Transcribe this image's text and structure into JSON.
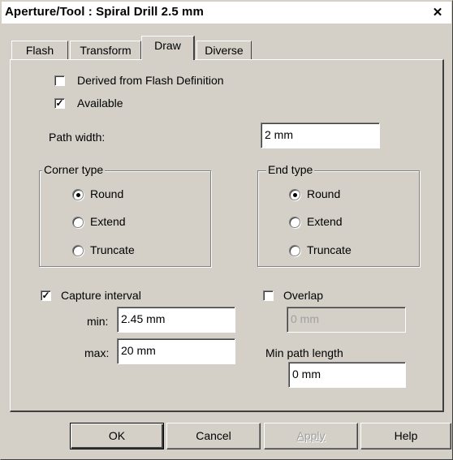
{
  "window": {
    "title": "Aperture/Tool : Spiral Drill 2.5 mm",
    "close_glyph": "✕"
  },
  "tabs": [
    {
      "label": "Flash"
    },
    {
      "label": "Transform"
    },
    {
      "label": "Draw",
      "active": true
    },
    {
      "label": "Diverse"
    }
  ],
  "draw": {
    "derived_label": "Derived from Flash Definition",
    "derived_checked": false,
    "available_label": "Available",
    "available_checked": true,
    "path_width_label": "Path width:",
    "path_width_value": "2 mm",
    "corner_type": {
      "legend": "Corner type",
      "options": [
        "Round",
        "Extend",
        "Truncate"
      ],
      "selected": "Round"
    },
    "end_type": {
      "legend": "End type",
      "options": [
        "Round",
        "Extend",
        "Truncate"
      ],
      "selected": "Round"
    },
    "capture_interval_label": "Capture interval",
    "capture_interval_checked": true,
    "min_label": "min:",
    "min_value": "2.45 mm",
    "max_label": "max:",
    "max_value": "20 mm",
    "overlap_label": "Overlap",
    "overlap_checked": false,
    "overlap_value": "0 mm",
    "min_path_length_label": "Min path length",
    "min_path_length_value": "0 mm"
  },
  "buttons": {
    "ok": "OK",
    "cancel": "Cancel",
    "apply": "Apply",
    "help": "Help"
  }
}
